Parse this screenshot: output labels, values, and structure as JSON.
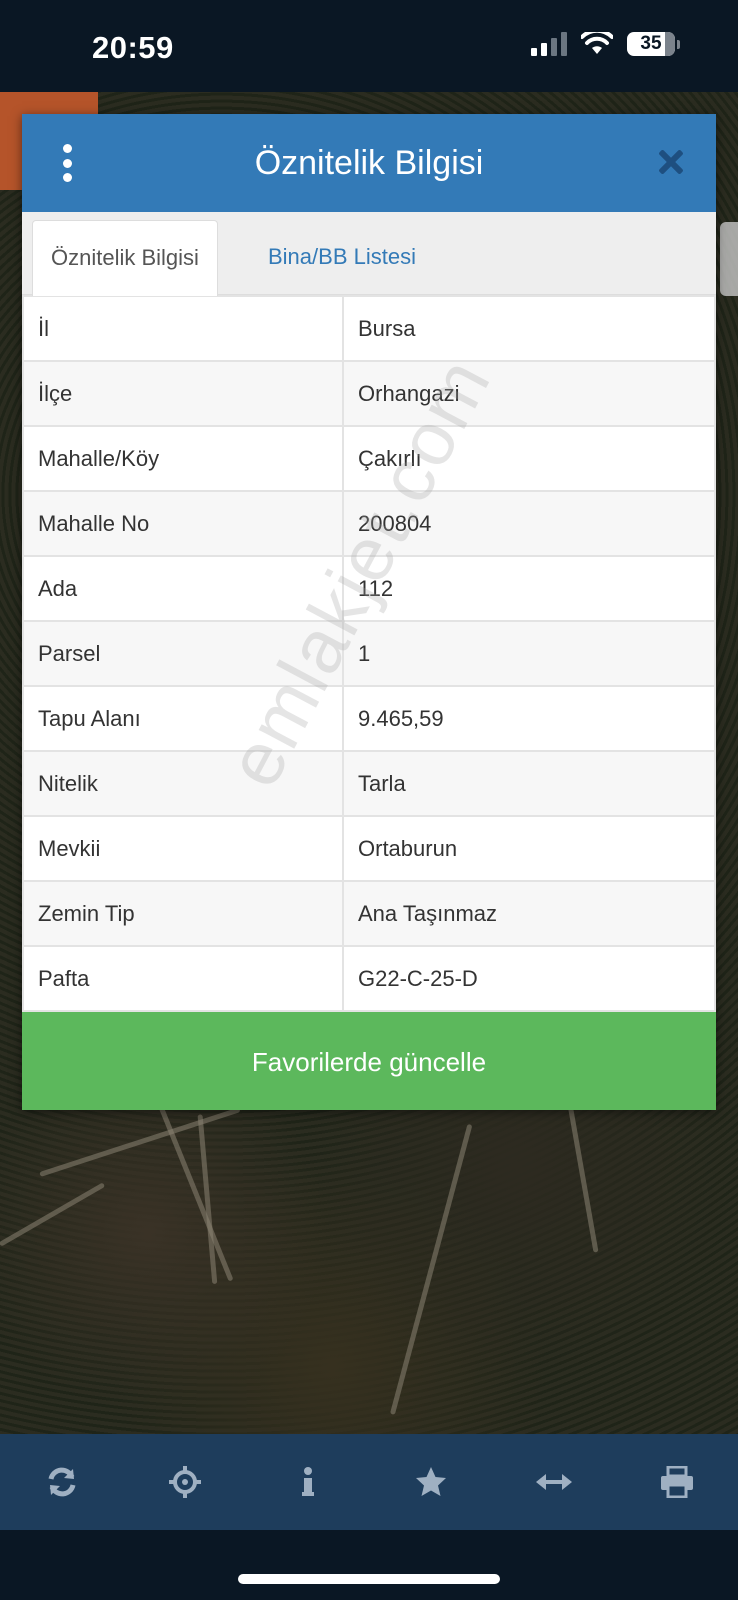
{
  "status_bar": {
    "time": "20:59",
    "battery": "35"
  },
  "modal": {
    "title": "Öznitelik Bilgisi",
    "tabs": [
      {
        "label": "Öznitelik Bilgisi",
        "active": true
      },
      {
        "label": "Bina/BB Listesi",
        "active": false
      }
    ],
    "rows": [
      {
        "key": "İl",
        "value": "Bursa"
      },
      {
        "key": "İlçe",
        "value": "Orhangazi"
      },
      {
        "key": "Mahalle/Köy",
        "value": "Çakırlı"
      },
      {
        "key": "Mahalle No",
        "value": "200804"
      },
      {
        "key": "Ada",
        "value": "112"
      },
      {
        "key": "Parsel",
        "value": "1"
      },
      {
        "key": "Tapu Alanı",
        "value": "9.465,59"
      },
      {
        "key": "Nitelik",
        "value": "Tarla"
      },
      {
        "key": "Mevkii",
        "value": "Ortaburun"
      },
      {
        "key": "Zemin Tip",
        "value": "Ana Taşınmaz"
      },
      {
        "key": "Pafta",
        "value": "G22-C-25-D"
      }
    ],
    "button_label": "Favorilerde güncelle"
  },
  "watermark": "emlakjet.com",
  "toolbar": {
    "icons": [
      "refresh-icon",
      "locate-crosshair-icon",
      "info-icon",
      "star-icon",
      "measure-arrows-icon",
      "print-icon"
    ]
  },
  "colors": {
    "header": "#337ab7",
    "button": "#5cb85c",
    "toolbar": "#1e3d5c"
  }
}
